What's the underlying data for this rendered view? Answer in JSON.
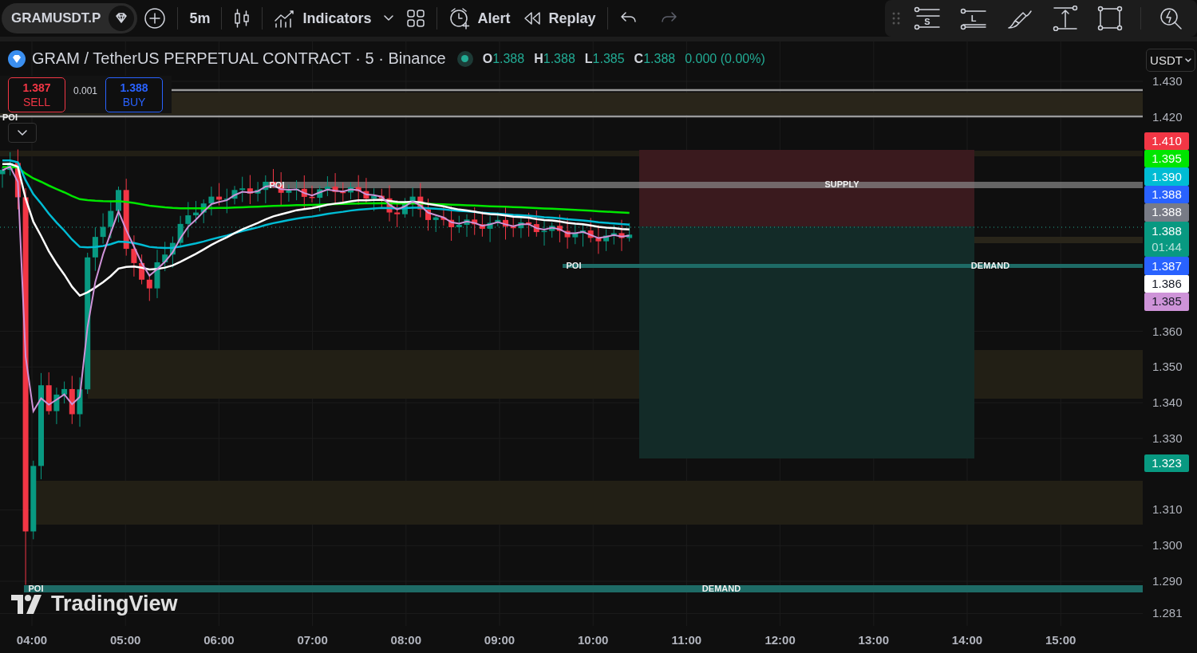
{
  "toolbar": {
    "symbol": "GRAMUSDT.P",
    "interval": "5m",
    "indicators": "Indicators",
    "alert": "Alert",
    "replay": "Replay",
    "undo": {
      "disabled": false
    },
    "redo": {
      "disabled": true
    },
    "drawing_tools": [
      "S",
      "L"
    ]
  },
  "legend": {
    "title": "GRAM / TetherUS PERPETUAL CONTRACT · 5 · Binance",
    "ohlc": [
      {
        "key": "O",
        "value": "1.388"
      },
      {
        "key": "H",
        "value": "1.388"
      },
      {
        "key": "L",
        "value": "1.385"
      },
      {
        "key": "C",
        "value": "1.388"
      }
    ],
    "change": "0.000 (0.00%)"
  },
  "trade": {
    "sell_price": "1.387",
    "sell": "SELL",
    "spread": "0.001",
    "buy_price": "1.388",
    "buy": "BUY"
  },
  "zone_labels": [
    "POI",
    "POI",
    "SUPPLY",
    "POI",
    "DEMAND",
    "POI",
    "DEMAND"
  ],
  "branding": "TradingView",
  "currency": "USDT",
  "price_axis": {
    "ticks": [
      "1.430",
      "1.420",
      "1.360",
      "1.350",
      "1.340",
      "1.330",
      "1.310",
      "1.300",
      "1.290",
      "1.281"
    ],
    "tags": [
      {
        "value": "1.410",
        "color": "#f23645"
      },
      {
        "value": "1.395",
        "color": "#00e600"
      },
      {
        "value": "1.390",
        "color": "#00bcd4"
      },
      {
        "value": "1.388",
        "color": "#2962ff"
      },
      {
        "value": "1.388",
        "color": "#787b86"
      },
      {
        "value": "1.388",
        "countdown": "01:44",
        "color": "#089981"
      },
      {
        "value": "1.387",
        "color": "#2962ff"
      },
      {
        "value": "1.386",
        "color": "#ffffff"
      },
      {
        "value": "1.385",
        "color": "#ce93d8"
      },
      {
        "value": "1.323",
        "color": "#089981"
      }
    ]
  },
  "time_axis": [
    "04:00",
    "05:00",
    "06:00",
    "07:00",
    "08:00",
    "09:00",
    "10:00",
    "11:00",
    "12:00",
    "13:00",
    "14:00",
    "15:00"
  ]
}
